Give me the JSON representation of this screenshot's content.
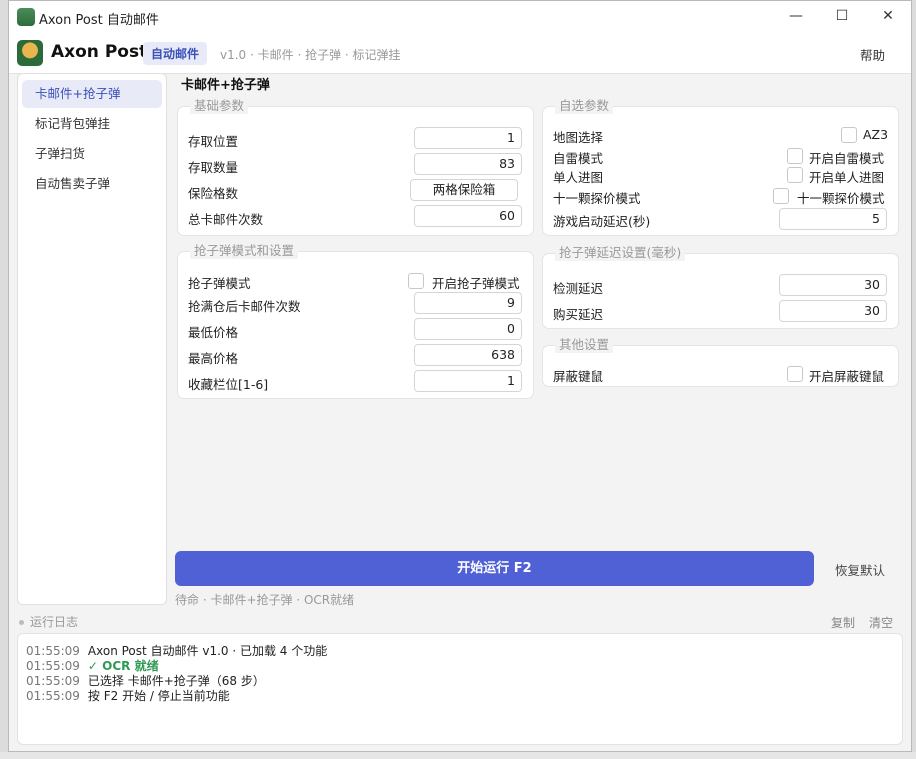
{
  "window": {
    "title": "Axon Post 自动邮件",
    "min": "—",
    "max": "☐",
    "close": "✕"
  },
  "header": {
    "brand": "Axon Post",
    "active_tab": "自动邮件",
    "breadcrumb": "v1.0 · 卡邮件 · 抢子弹 · 标记弹挂",
    "help": "帮助"
  },
  "sidebar": {
    "items": [
      {
        "label": "卡邮件+抢子弹",
        "active": true
      },
      {
        "label": "标记背包弹挂",
        "active": false
      },
      {
        "label": "子弹扫货",
        "active": false
      },
      {
        "label": "自动售卖子弹",
        "active": false
      }
    ]
  },
  "main": {
    "title": "卡邮件+抢子弹"
  },
  "basic": {
    "legend": "基础参数",
    "rows": [
      {
        "label": "存取位置",
        "value": "1"
      },
      {
        "label": "存取数量",
        "value": "83"
      },
      {
        "label": "保险格数",
        "value": "两格保险箱"
      },
      {
        "label": "总卡邮件次数",
        "value": "60"
      }
    ]
  },
  "optional": {
    "legend": "自选参数",
    "map_label": "地图选择",
    "map_value": "AZ3",
    "auto_mine_label": "自雷模式",
    "auto_mine_chk": "开启自雷模式",
    "single_label": "单人进图",
    "single_chk": "开启单人进图",
    "probe_label": "十一颗探价模式",
    "probe_chk": "十一颗探价模式",
    "delay_label": "游戏启动延迟(秒)",
    "delay_value": "5"
  },
  "grab": {
    "legend": "抢子弹模式和设置",
    "mode_label": "抢子弹模式",
    "mode_chk": "开启抢子弹模式",
    "rows": [
      {
        "label": "抢满仓后卡邮件次数",
        "value": "9"
      },
      {
        "label": "最低价格",
        "value": "0"
      },
      {
        "label": "最高价格",
        "value": "638"
      },
      {
        "label": "收藏栏位[1-6]",
        "value": "1"
      }
    ]
  },
  "delay": {
    "legend": "抢子弹延迟设置(毫秒)",
    "rows": [
      {
        "label": "检测延迟",
        "value": "30"
      },
      {
        "label": "购买延迟",
        "value": "30"
      }
    ]
  },
  "other": {
    "legend": "其他设置",
    "block_label": "屏蔽键鼠",
    "block_chk": "开启屏蔽键鼠"
  },
  "actions": {
    "run": "开始运行  F2",
    "reset": "恢复默认",
    "status": "待命  ·  卡邮件+抢子弹  ·  OCR就绪"
  },
  "log": {
    "title": "运行日志",
    "copy": "复制",
    "clear": "清空",
    "lines": [
      {
        "time": "01:55:09",
        "text": "Axon Post 自动邮件 v1.0 · 已加载 4 个功能"
      },
      {
        "time": "01:55:09",
        "text": "✓ OCR 就绪"
      },
      {
        "time": "01:55:09",
        "text": "已选择 卡邮件+抢子弹（68 步）"
      },
      {
        "time": "01:55:09",
        "text": "按 F2 开始 / 停止当前功能"
      }
    ]
  }
}
